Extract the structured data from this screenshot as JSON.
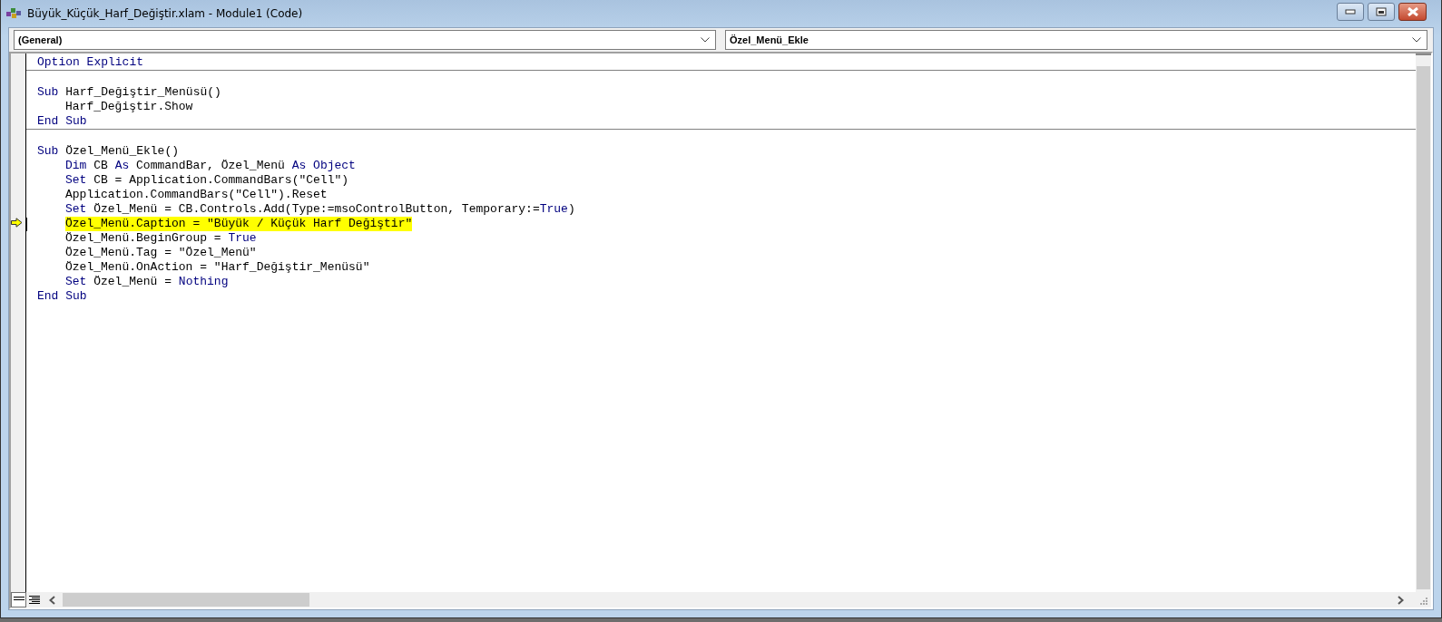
{
  "window": {
    "title": "Büyük_Küçük_Harf_Değiştir.xlam - Module1 (Code)"
  },
  "object_dropdown": {
    "value": "(General)"
  },
  "procedure_dropdown": {
    "value": "Özel_Menü_Ekle"
  },
  "code": {
    "sections": [
      {
        "opening": [
          {
            "kind": "keyword",
            "text": "Option Explicit"
          }
        ]
      },
      {
        "opening": [
          {
            "kind": "keyword",
            "text": "Sub"
          },
          {
            "kind": "plain",
            "text": " Harf_Değiştir_Menüsü()"
          }
        ],
        "body": [
          {
            "current": false,
            "tokens": [
              {
                "kind": "plain",
                "text": "Harf_Değiştir.Show"
              }
            ]
          }
        ],
        "closing": [
          {
            "kind": "keyword",
            "text": "End Sub"
          }
        ]
      },
      {
        "opening": [
          {
            "kind": "keyword",
            "text": "Sub"
          },
          {
            "kind": "plain",
            "text": " Özel_Menü_Ekle()"
          }
        ],
        "body": [
          {
            "current": false,
            "tokens": [
              {
                "kind": "keyword",
                "text": "Dim"
              },
              {
                "kind": "plain",
                "text": " CB "
              },
              {
                "kind": "keyword",
                "text": "As"
              },
              {
                "kind": "plain",
                "text": " CommandBar, Özel_Menü "
              },
              {
                "kind": "keyword",
                "text": "As Object"
              }
            ]
          },
          {
            "current": false,
            "tokens": [
              {
                "kind": "keyword",
                "text": "Set"
              },
              {
                "kind": "plain",
                "text": " CB = Application.CommandBars(\"Cell\")"
              }
            ]
          },
          {
            "current": false,
            "tokens": [
              {
                "kind": "plain",
                "text": "Application.CommandBars(\"Cell\").Reset"
              }
            ]
          },
          {
            "current": false,
            "tokens": [
              {
                "kind": "keyword",
                "text": "Set"
              },
              {
                "kind": "plain",
                "text": " Özel_Menü = CB.Controls.Add(Type:=msoControlButton, Temporary:="
              },
              {
                "kind": "keyword",
                "text": "True"
              },
              {
                "kind": "plain",
                "text": ")"
              }
            ]
          },
          {
            "current": true,
            "tokens": [
              {
                "kind": "plain",
                "text": "Özel_Menü.Caption = \"Büyük / Küçük Harf Değiştir\""
              }
            ]
          },
          {
            "current": false,
            "tokens": [
              {
                "kind": "plain",
                "text": "Özel_Menü.BeginGroup = "
              },
              {
                "kind": "keyword",
                "text": "True"
              }
            ]
          },
          {
            "current": false,
            "tokens": [
              {
                "kind": "plain",
                "text": "Özel_Menü.Tag = \"Özel_Menü\""
              }
            ]
          },
          {
            "current": false,
            "tokens": [
              {
                "kind": "plain",
                "text": "Özel_Menü.OnAction = \"Harf_Değiştir_Menüsü\""
              }
            ]
          },
          {
            "current": false,
            "tokens": [
              {
                "kind": "keyword",
                "text": "Set"
              },
              {
                "kind": "plain",
                "text": " Özel_Menü = "
              },
              {
                "kind": "keyword",
                "text": "Nothing"
              }
            ]
          }
        ],
        "closing": [
          {
            "kind": "keyword",
            "text": "End Sub"
          }
        ]
      }
    ]
  },
  "view_buttons": [
    {
      "kind": "procedure",
      "selected": true
    },
    {
      "kind": "module",
      "selected": false
    }
  ]
}
